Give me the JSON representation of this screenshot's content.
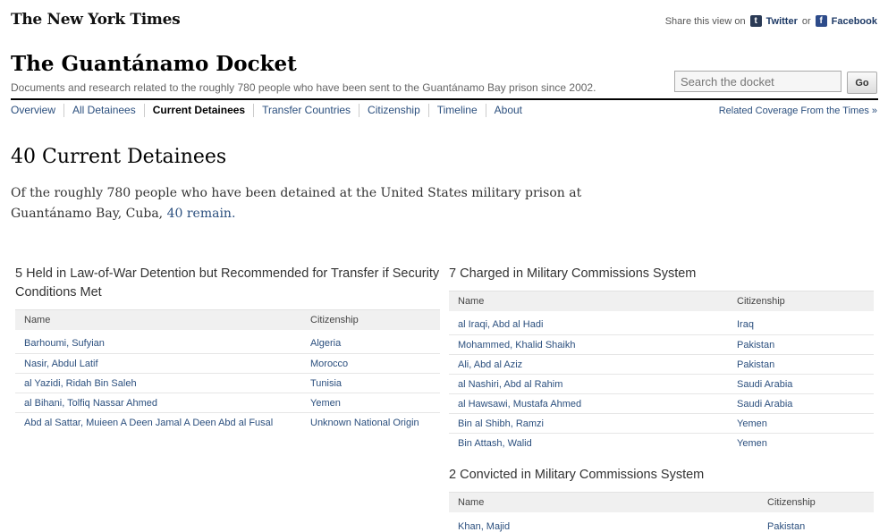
{
  "masthead": {
    "logo_text": "The New York Times"
  },
  "share": {
    "label": "Share this view on",
    "twitter_icon": "t",
    "twitter": "Twitter",
    "or": "or",
    "facebook_icon": "f",
    "facebook": "Facebook"
  },
  "header": {
    "title": "The Guantánamo Docket",
    "subtitle": "Documents and research related to the roughly 780 people who have been sent to the Guantánamo Bay prison since 2002."
  },
  "search": {
    "placeholder": "Search the docket",
    "button": "Go"
  },
  "nav": {
    "items": [
      {
        "label": "Overview"
      },
      {
        "label": "All Detainees"
      },
      {
        "label": "Current Detainees"
      },
      {
        "label": "Transfer Countries"
      },
      {
        "label": "Citizenship"
      },
      {
        "label": "Timeline"
      },
      {
        "label": "About"
      }
    ],
    "active": "Current Detainees",
    "related": "Related Coverage From the Times »"
  },
  "main": {
    "title": "40 Current Detainees",
    "intro_text": "Of the roughly 780 people who have been detained at the United States military prison at Guantánamo Bay, Cuba,",
    "intro_highlight": "40 remain."
  },
  "sections": [
    {
      "heading": "5 Held in Law-of-War Detention but Recommended for Transfer if Security Conditions Met",
      "col_name": "Name",
      "col_citizenship": "Citizenship",
      "rows": [
        {
          "name": "Barhoumi, Sufyian",
          "citizenship": "Algeria"
        },
        {
          "name": "Nasir, Abdul Latif",
          "citizenship": "Morocco"
        },
        {
          "name": "al Yazidi, Ridah Bin Saleh",
          "citizenship": "Tunisia"
        },
        {
          "name": "al Bihani, Tolfiq Nassar Ahmed",
          "citizenship": "Yemen"
        },
        {
          "name": "Abd al Sattar, Muieen A Deen Jamal A Deen Abd al Fusal",
          "citizenship": "Unknown National Origin"
        }
      ]
    },
    {
      "heading": "7 Charged in Military Commissions System",
      "col_name": "Name",
      "col_citizenship": "Citizenship",
      "rows": [
        {
          "name": "al Iraqi, Abd al Hadi",
          "citizenship": "Iraq"
        },
        {
          "name": "Mohammed, Khalid Shaikh",
          "citizenship": "Pakistan"
        },
        {
          "name": "Ali, Abd al Aziz",
          "citizenship": "Pakistan"
        },
        {
          "name": "al Nashiri, Abd al Rahim",
          "citizenship": "Saudi Arabia"
        },
        {
          "name": "al Hawsawi, Mustafa Ahmed",
          "citizenship": "Saudi Arabia"
        },
        {
          "name": "Bin al Shibh, Ramzi",
          "citizenship": "Yemen"
        },
        {
          "name": "Bin Attash, Walid",
          "citizenship": "Yemen"
        }
      ]
    },
    {
      "heading": "2 Convicted in Military Commissions System",
      "col_name": "Name",
      "col_citizenship": "Citizenship",
      "rows": [
        {
          "name": "Khan, Majid",
          "citizenship": "Pakistan"
        }
      ]
    }
  ]
}
